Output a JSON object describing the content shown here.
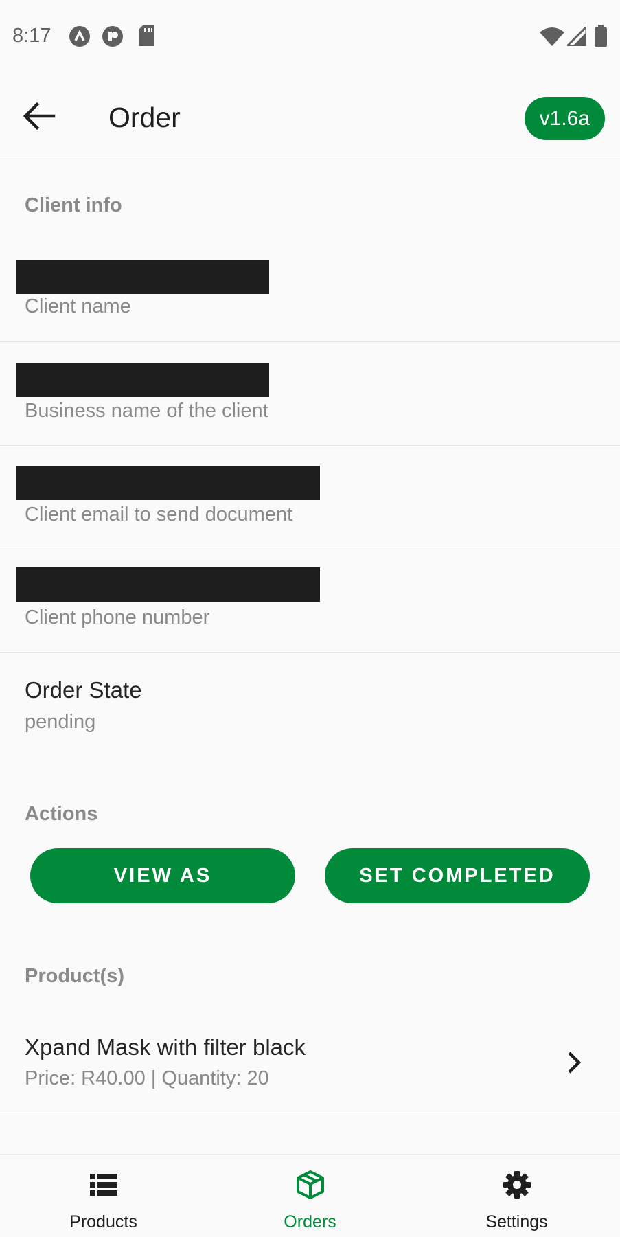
{
  "status_bar": {
    "time": "8:17",
    "icons": [
      "app-a-icon",
      "app-p-icon",
      "sd-card-icon",
      "wifi-icon",
      "signal-icon",
      "battery-icon"
    ]
  },
  "app_bar": {
    "title": "Order",
    "version": "v1.6a",
    "back_icon": "arrow-back-icon"
  },
  "client_info": {
    "section_title": "Client info",
    "fields": [
      {
        "label": "Client name",
        "value": "[redacted]"
      },
      {
        "label": "Business name of the client",
        "value": "[redacted]"
      },
      {
        "label": "Client email to send document",
        "value": "[redacted]"
      },
      {
        "label": "Client phone number",
        "value": "[redacted]"
      }
    ]
  },
  "order_state": {
    "title": "Order State",
    "value": "pending"
  },
  "actions": {
    "section_title": "Actions",
    "view_as_label": "VIEW AS",
    "set_completed_label": "SET COMPLETED"
  },
  "products": {
    "section_title": "Product(s)",
    "items": [
      {
        "name": "Xpand Mask with filter black",
        "meta": "Price: R40.00 | Quantity: 20"
      }
    ]
  },
  "bottom_nav": {
    "items": [
      {
        "label": "Products",
        "icon": "list-icon",
        "active": false
      },
      {
        "label": "Orders",
        "icon": "package-icon",
        "active": true
      },
      {
        "label": "Settings",
        "icon": "gear-icon",
        "active": false
      }
    ]
  },
  "colors": {
    "accent": "#008a3a",
    "background": "#fafafa",
    "secondary_text": "#8a8a8a",
    "redaction": "#1e1e1e"
  }
}
